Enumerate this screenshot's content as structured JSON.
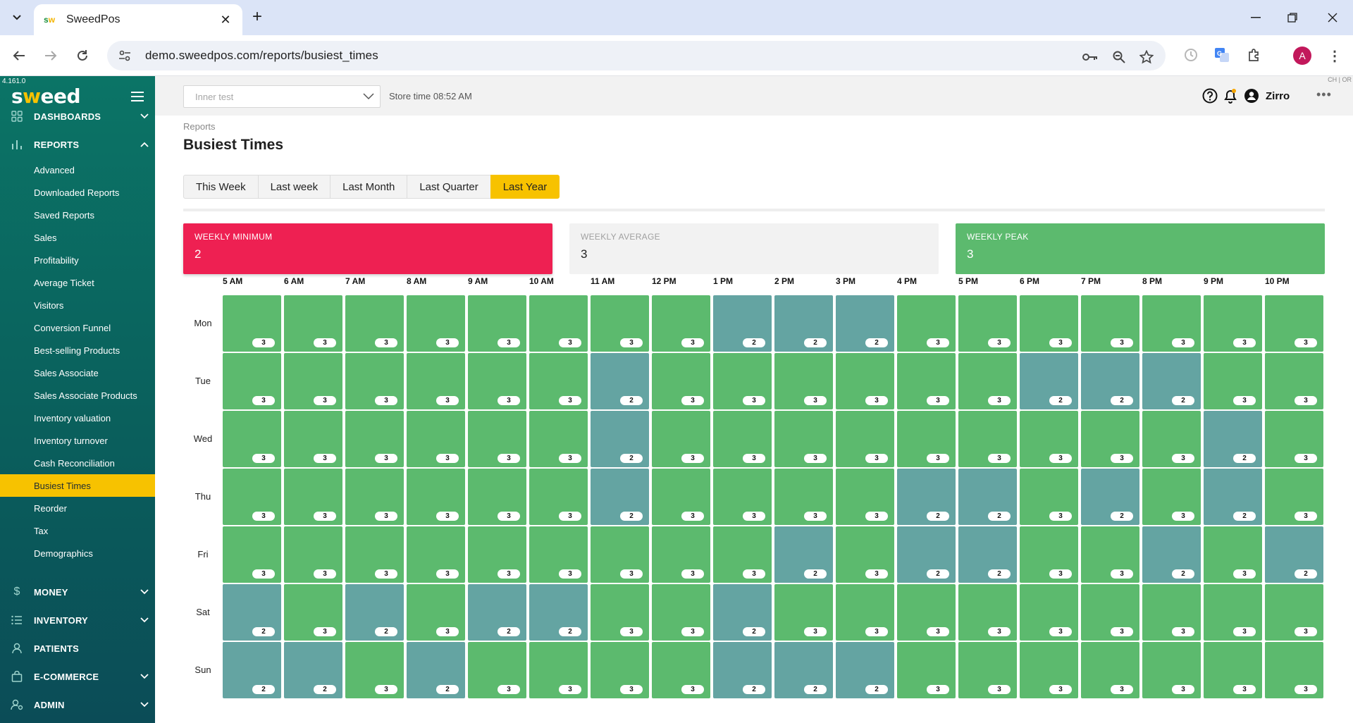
{
  "browser": {
    "tab_title": "SweedPos",
    "url": "demo.sweedpos.com/reports/busiest_times",
    "profile_initial": "A"
  },
  "app": {
    "version": "4.161.0",
    "logo_text": "sweed",
    "store_placeholder": "Inner test",
    "store_time": "Store time 08:52 AM",
    "header_tag": "CH | OR",
    "user_name": "Zirro"
  },
  "sidebar": {
    "sections": [
      {
        "label": "DASHBOARDS",
        "icon": "grid-icon",
        "expanded": false
      },
      {
        "label": "REPORTS",
        "icon": "bar-chart-icon",
        "expanded": true
      },
      {
        "label": "MONEY",
        "icon": "dollar-icon",
        "expanded": false
      },
      {
        "label": "INVENTORY",
        "icon": "list-icon",
        "expanded": false
      },
      {
        "label": "PATIENTS",
        "icon": "person-icon",
        "expanded": false
      },
      {
        "label": "E-COMMERCE",
        "icon": "shopping-bag-icon",
        "expanded": false
      },
      {
        "label": "ADMIN",
        "icon": "admin-user-icon",
        "expanded": false
      }
    ],
    "report_items": [
      "Advanced",
      "Downloaded Reports",
      "Saved Reports",
      "Sales",
      "Profitability",
      "Average Ticket",
      "Visitors",
      "Conversion Funnel",
      "Best-selling Products",
      "Sales Associate",
      "Sales Associate Products",
      "Inventory valuation",
      "Inventory turnover",
      "Cash Reconciliation",
      "Busiest Times",
      "Reorder",
      "Tax",
      "Demographics"
    ],
    "active_item": "Busiest Times"
  },
  "page": {
    "breadcrumb": "Reports",
    "title": "Busiest Times",
    "periods": [
      "This Week",
      "Last week",
      "Last Month",
      "Last Quarter",
      "Last Year"
    ],
    "active_period": "Last Year"
  },
  "stats": {
    "min_label": "WEEKLY MINIMUM",
    "min_value": "2",
    "avg_label": "WEEKLY AVERAGE",
    "avg_value": "3",
    "peak_label": "WEEKLY PEAK",
    "peak_value": "3"
  },
  "colors": {
    "accent": "#f7c200",
    "minimum": "#ee2052",
    "peak": "#5cba6e",
    "low_cell": "#64a4a2",
    "sidebar": "#0a5f5c"
  },
  "chart_data": {
    "type": "heatmap",
    "x": [
      "5 AM",
      "6 AM",
      "7 AM",
      "8 AM",
      "9 AM",
      "10 AM",
      "11 AM",
      "12 PM",
      "1 PM",
      "2 PM",
      "3 PM",
      "4 PM",
      "5 PM",
      "6 PM",
      "7 PM",
      "8 PM",
      "9 PM",
      "10 PM"
    ],
    "y": [
      "Mon",
      "Tue",
      "Wed",
      "Thu",
      "Fri",
      "Sat",
      "Sun"
    ],
    "values": [
      [
        3,
        3,
        3,
        3,
        3,
        3,
        3,
        3,
        2,
        2,
        2,
        3,
        3,
        3,
        3,
        3,
        3,
        3
      ],
      [
        3,
        3,
        3,
        3,
        3,
        3,
        2,
        3,
        3,
        3,
        3,
        3,
        3,
        2,
        2,
        2,
        3,
        3
      ],
      [
        3,
        3,
        3,
        3,
        3,
        3,
        2,
        3,
        3,
        3,
        3,
        3,
        3,
        3,
        3,
        3,
        2,
        3
      ],
      [
        3,
        3,
        3,
        3,
        3,
        3,
        2,
        3,
        3,
        3,
        3,
        2,
        2,
        3,
        2,
        3,
        2,
        3
      ],
      [
        3,
        3,
        3,
        3,
        3,
        3,
        3,
        3,
        3,
        2,
        3,
        2,
        2,
        3,
        3,
        2,
        3,
        2
      ],
      [
        2,
        3,
        2,
        3,
        2,
        2,
        3,
        3,
        2,
        3,
        3,
        3,
        3,
        3,
        3,
        3,
        3,
        3
      ],
      [
        2,
        2,
        3,
        2,
        3,
        3,
        3,
        3,
        2,
        2,
        2,
        3,
        3,
        3,
        3,
        3,
        3,
        3
      ]
    ]
  }
}
